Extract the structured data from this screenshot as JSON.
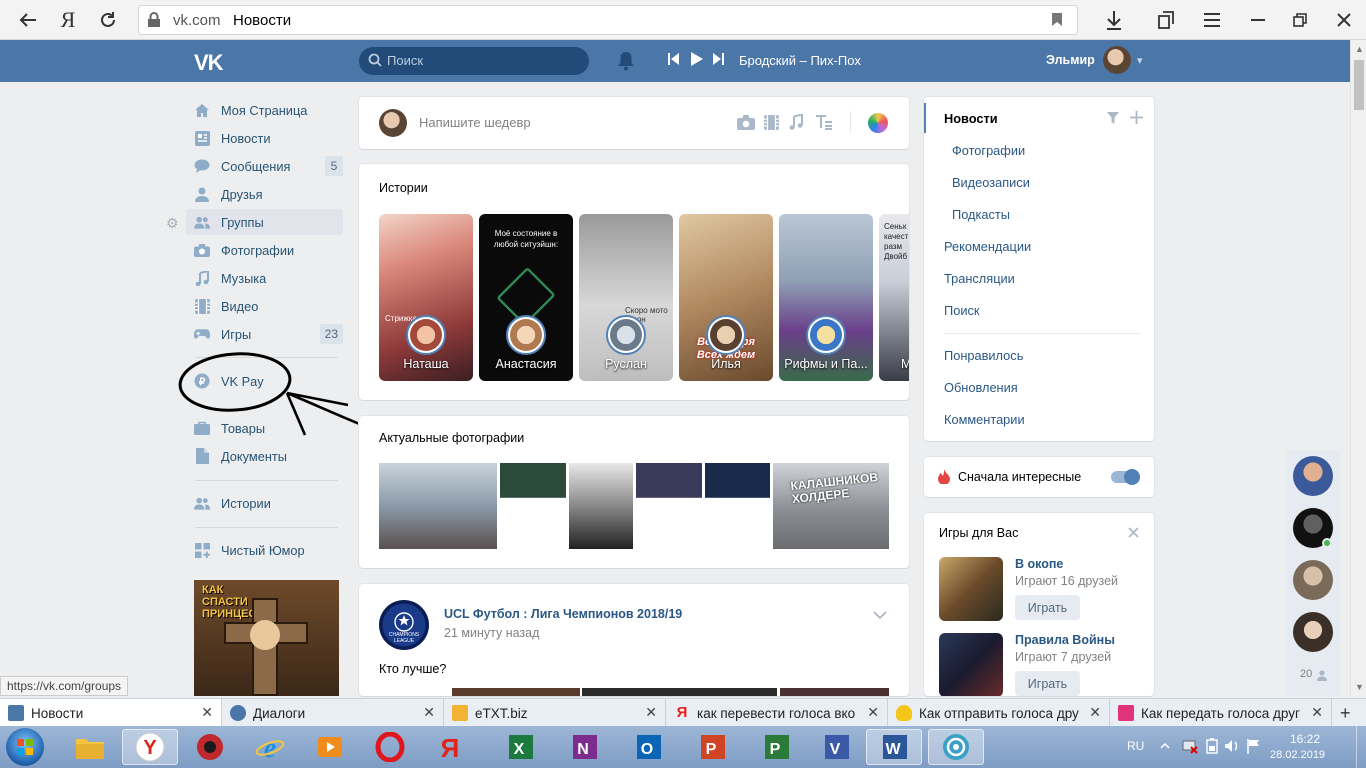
{
  "browser": {
    "domain": "vk.com",
    "page_title": "Новости",
    "status_url": "https://vk.com/groups"
  },
  "header": {
    "logo": "VK",
    "search_placeholder": "Поиск",
    "track": "Бродский – Пих-Пох",
    "user_name": "Эльмир"
  },
  "left_menu": {
    "items": [
      {
        "label": "Моя Страница",
        "icon": "user-icon"
      },
      {
        "label": "Новости",
        "icon": "news-icon"
      },
      {
        "label": "Сообщения",
        "icon": "messages-icon",
        "counter": "5"
      },
      {
        "label": "Друзья",
        "icon": "friends-icon"
      },
      {
        "label": "Группы",
        "icon": "groups-icon"
      },
      {
        "label": "Фотографии",
        "icon": "camera-icon"
      },
      {
        "label": "Музыка",
        "icon": "music-icon"
      },
      {
        "label": "Видео",
        "icon": "video-icon"
      },
      {
        "label": "Игры",
        "icon": "games-icon",
        "counter": "23"
      },
      {
        "label": "VK Pay",
        "icon": "vkpay-icon"
      },
      {
        "label": "Товары",
        "icon": "goods-icon"
      },
      {
        "label": "Документы",
        "icon": "documents-icon"
      },
      {
        "label": "Истории",
        "icon": "stories-icon"
      },
      {
        "label": "Чистый Юмор",
        "icon": "apps-icon"
      }
    ],
    "ad_text": "КАК СПАСТИ ПРИНЦЕССУ?"
  },
  "composer": {
    "placeholder": "Напишите шедевр"
  },
  "stories": {
    "title": "Истории",
    "items": [
      {
        "name": "Наташа",
        "caption": "Стрижка"
      },
      {
        "name": "Анастасия",
        "caption": "Моё состояние в любой ситуэйшн:"
      },
      {
        "name": "Руслан",
        "caption": "Скоро мото сезон"
      },
      {
        "name": "Илья",
        "caption": "Всё не зря Всех ждем"
      },
      {
        "name": "Рифмы и Па...",
        "caption": ""
      },
      {
        "name": "М",
        "caption": "Сеньк качест разм Двойб"
      }
    ]
  },
  "photos": {
    "title": "Актуальные фотографии",
    "overlay": "КАЛАШНИКОВ ХОЛДЕРЕ"
  },
  "post": {
    "group": "UCL Футбол : Лига Чемпионов 2018/19",
    "time": "21 минуту назад",
    "text": "Кто лучше?",
    "logo_text": "CHAMPIONS LEAGUE"
  },
  "right_nav": {
    "items": [
      "Новости",
      "Фотографии",
      "Видеозаписи",
      "Подкасты",
      "Рекомендации",
      "Трансляции",
      "Поиск",
      "Понравилось",
      "Обновления",
      "Комментарии"
    ]
  },
  "interesting_first": {
    "label": "Сначала интересные",
    "enabled": true
  },
  "games": {
    "title": "Игры для Вас",
    "items": [
      {
        "name": "В окопе",
        "friends": "Играют 16 друзей",
        "button": "Играть"
      },
      {
        "name": "Правила Войны",
        "friends": "Играют 7 друзей",
        "button": "Играть"
      }
    ]
  },
  "friends_online": {
    "count": "20"
  },
  "annotation": {
    "description": "hand-drawn circle and arrow around VK Pay"
  },
  "window_tabs": [
    {
      "title": "Новости",
      "icon_color": "#4a76a8"
    },
    {
      "title": "Диалоги",
      "icon_color": "#4a76a8"
    },
    {
      "title": "eTXT.biz",
      "icon_color": "#f2b233"
    },
    {
      "title": "как перевести голоса вко",
      "icon_color": "#e2231a"
    },
    {
      "title": "Как отправить голоса дру",
      "icon_color": "#f5c518"
    },
    {
      "title": "Как передать голоса друг",
      "icon_color": "#e0337a"
    }
  ],
  "taskbar": {
    "lang": "RU",
    "time": "16:22",
    "date": "28.02.2019"
  },
  "colors": {
    "vk_blue": "#4a76a8",
    "link": "#2a5885",
    "background": "#edeef0"
  }
}
